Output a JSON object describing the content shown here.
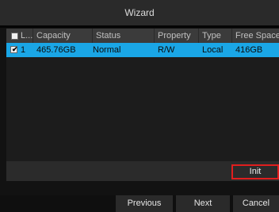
{
  "window": {
    "title": "Wizard"
  },
  "table": {
    "headers": {
      "select": "L...",
      "capacity": "Capacity",
      "status": "Status",
      "property": "Property",
      "type": "Type",
      "free_space": "Free Space"
    },
    "rows": [
      {
        "checked": true,
        "index": "1",
        "capacity": "465.76GB",
        "status": "Normal",
        "property": "R/W",
        "type": "Local",
        "free_space": "416GB"
      }
    ]
  },
  "actions": {
    "init_label": "Init"
  },
  "nav": {
    "previous_label": "Previous",
    "next_label": "Next",
    "cancel_label": "Cancel"
  },
  "colors": {
    "selected_row": "#1aa6e6",
    "init_highlight": "#e01e1e"
  }
}
